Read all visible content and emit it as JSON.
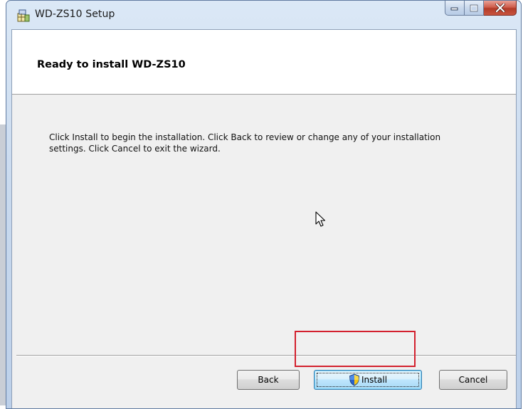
{
  "window": {
    "title": "WD-ZS10 Setup",
    "icons": {
      "app": "setup-installer-icon",
      "minimize": "minimize-icon",
      "maximize": "maximize-icon",
      "close": "close-icon"
    }
  },
  "banner": {
    "title": "Ready to install WD-ZS10"
  },
  "body": {
    "message": "Click Install to begin the installation. Click Back to review or change any of your installation settings. Click Cancel to exit the wizard."
  },
  "buttons": {
    "back": "Back",
    "install": "Install",
    "cancel": "Cancel"
  },
  "colors": {
    "highlight": "#d3202e",
    "close_button": "#c9543f"
  }
}
